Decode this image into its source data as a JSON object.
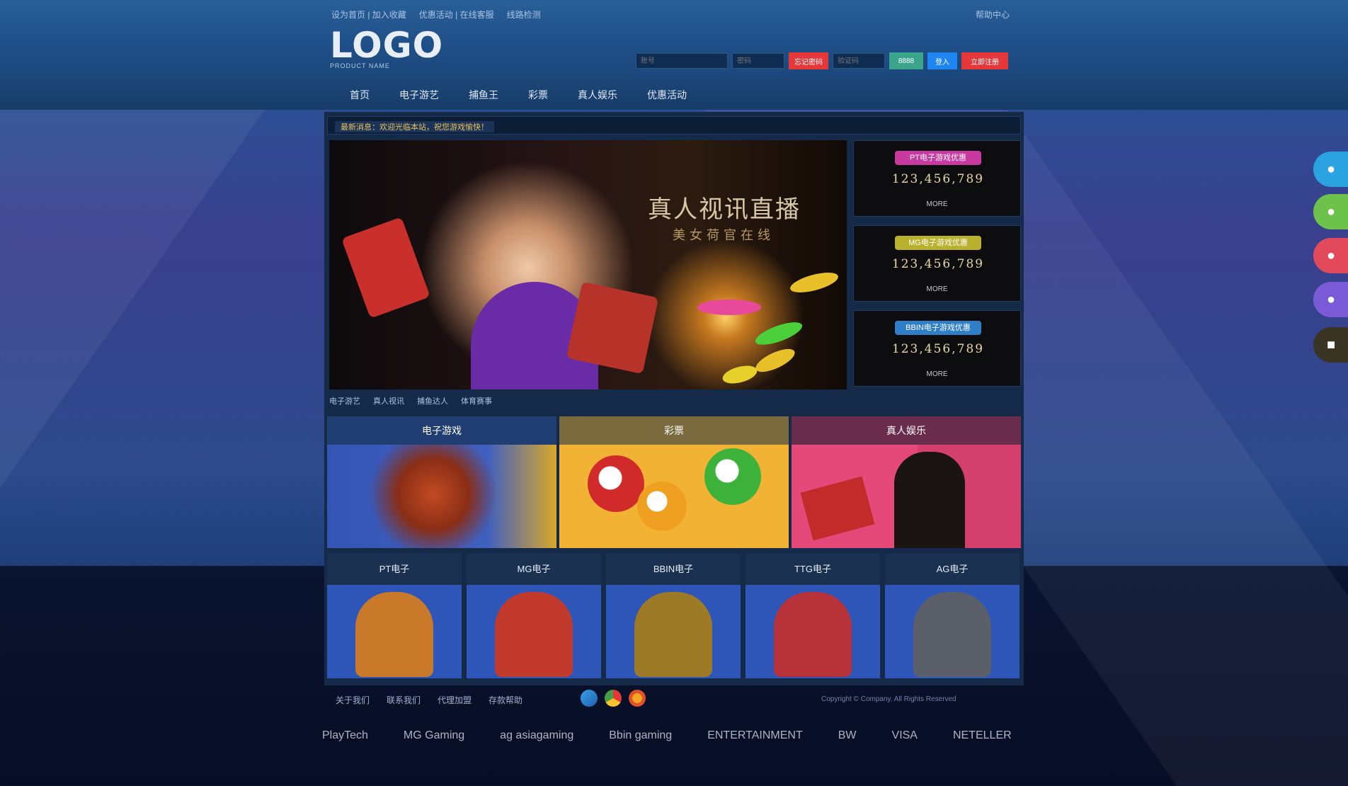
{
  "header": {
    "top_links": [
      "设为首页 | 加入收藏",
      "优惠活动 | 在线客服",
      "线路检测",
      "帮助中心"
    ],
    "help_link": "帮助中心",
    "logo_text": "LOGO",
    "logo_sub": "PRODUCT NAME",
    "login": {
      "username_placeholder": "账号",
      "password_placeholder": "密码",
      "forgot_label": "忘记密码",
      "code_placeholder": "验证码",
      "code_label": "8888",
      "login_label": "登入",
      "register_label": "立即注册"
    }
  },
  "nav": {
    "items": [
      "首页",
      "电子游艺",
      "捕鱼王",
      "彩票",
      "真人娱乐",
      "优惠活动"
    ]
  },
  "marquee": {
    "text": "最新消息：欢迎光临本站，祝您游戏愉快！"
  },
  "banner": {
    "title": "真人视讯直播",
    "subtitle": "美女荷官在线"
  },
  "promos": [
    {
      "tag": "PT电子游戏优惠",
      "number": "123,456,789",
      "link": "MORE"
    },
    {
      "tag": "MG电子游戏优惠",
      "number": "123,456,789",
      "link": "MORE"
    },
    {
      "tag": "BBIN电子游戏优惠",
      "number": "123,456,789",
      "link": "MORE"
    }
  ],
  "game_nav": [
    "电子游艺",
    "真人视讯",
    "捕鱼达人",
    "体育赛事"
  ],
  "tiles": {
    "big": [
      {
        "label": "电子游戏"
      },
      {
        "label": "彩票"
      },
      {
        "label": "真人娱乐"
      }
    ],
    "small": [
      {
        "label": "PT电子"
      },
      {
        "label": "MG电子"
      },
      {
        "label": "BBIN电子"
      },
      {
        "label": "TTG电子"
      },
      {
        "label": "AG电子"
      }
    ]
  },
  "footer": {
    "links": [
      "关于我们",
      "联系我们",
      "代理加盟",
      "存款帮助"
    ],
    "copyright": "Copyright © Company. All Rights Reserved",
    "partners": [
      "PlayTech",
      "MG Gaming",
      "ag asiagaming",
      "Bbin gaming",
      "ENTERTAINMENT",
      "BW",
      "VISA",
      "NETELLER"
    ]
  },
  "side_icons": [
    "qq-icon",
    "wechat-icon",
    "service-icon",
    "chat-icon",
    "app-icon"
  ],
  "colors": {
    "accent_red": "#e5383b",
    "accent_teal": "#3aa58a",
    "accent_blue": "#1e86f0",
    "gold": "#e8c15a"
  }
}
